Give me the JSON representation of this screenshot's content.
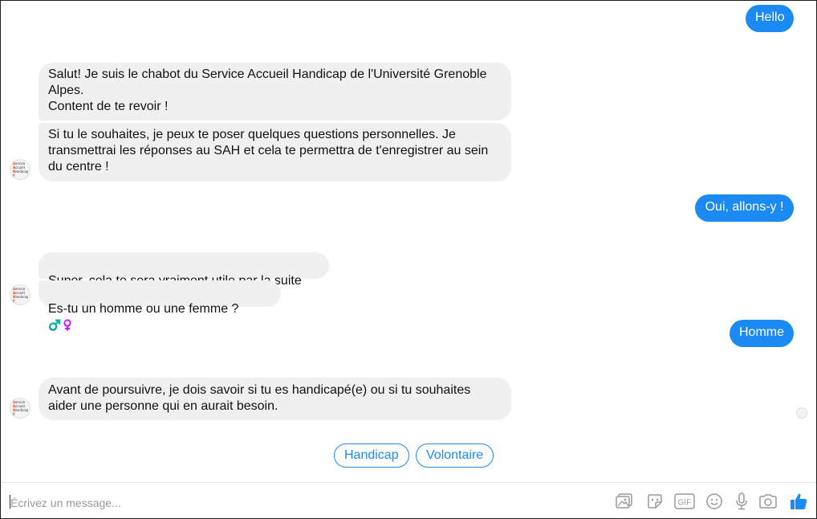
{
  "avatar": {
    "lines": [
      "Service",
      "Accueil",
      "Handicap",
      "fr"
    ]
  },
  "messages": {
    "hello": "Hello",
    "bot1a": "Salut! Je suis le chabot du Service Accueil Handicap de l'Université Grenoble Alpes.\nContent de te revoir !",
    "bot1b": "Si tu le souhaites, je peux te poser quelques questions personnelles. Je transmettrai les réponses au SAH et cela te permettra de t'enregistrer au sein du centre !",
    "allons": "Oui, allons-y !",
    "bot2a": "Super, cela te sera vraiment utile par la suite",
    "bot2a_emoji": "😁",
    "bot2b": "Es-tu un homme ou une femme ?",
    "bot2b_emoji": "♂️♀️",
    "homme": "Homme",
    "bot3": "Avant de poursuivre, je dois savoir si tu es handicapé(e) ou si tu souhaites aider une personne qui en aurait besoin."
  },
  "quick_replies": {
    "handicap": "Handicap",
    "volontaire": "Volontaire"
  },
  "composer": {
    "placeholder": "Écrivez un message...",
    "icons": [
      "image-icon",
      "sticker-icon",
      "gif-icon",
      "emoji-icon",
      "microphone-icon",
      "camera-icon",
      "thumbs-up-icon"
    ],
    "gif_label": "GIF",
    "accent": "#1b8af2"
  }
}
